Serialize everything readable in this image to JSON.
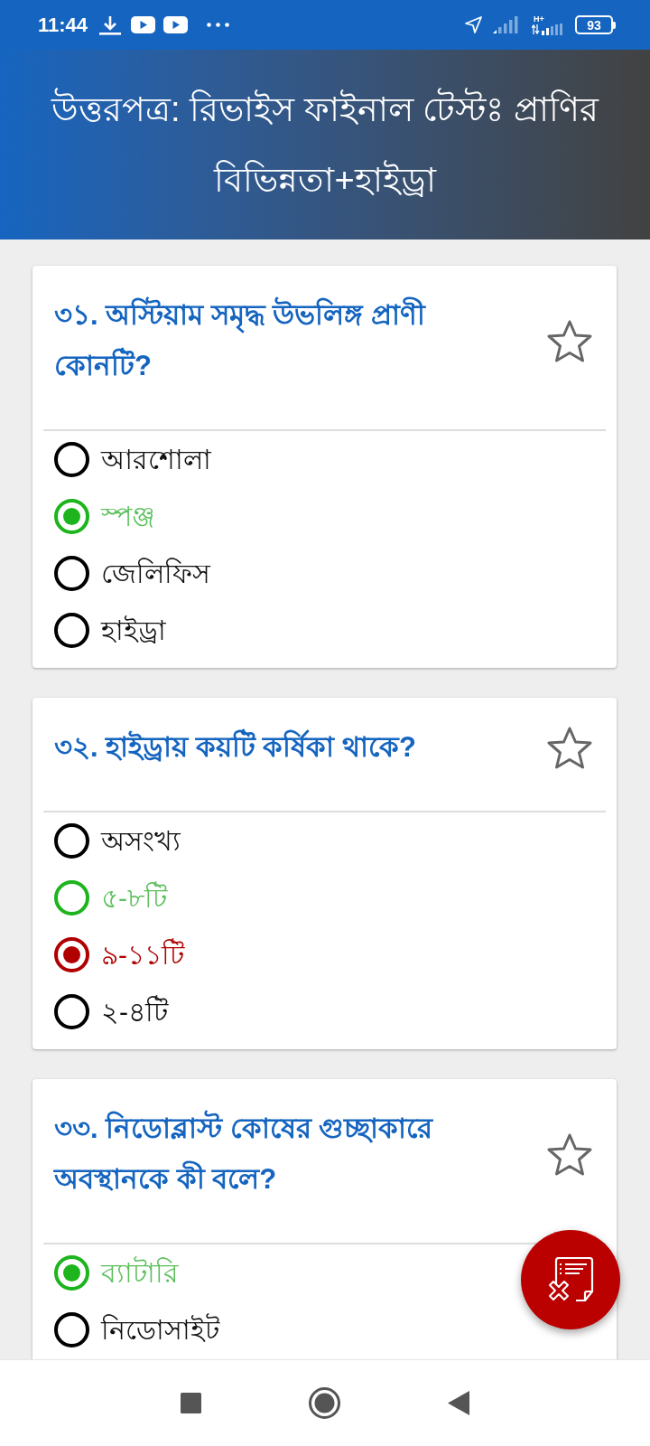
{
  "status_bar": {
    "time": "11:44",
    "network_type": "H+",
    "battery": "93"
  },
  "header": {
    "title": "উত্তরপত্র: রিভাইস ফাইনাল টেস্টঃ প্রাণির বিভিন্নতা+হাইড্রা"
  },
  "questions": [
    {
      "text": "৩১. অস্টিয়াম সমৃদ্ধ উভলিঙ্গ প্রাণী কোনটি?",
      "starred": false,
      "options": [
        {
          "text": "আরশোলা",
          "selected": false,
          "correct": false
        },
        {
          "text": "স্পঞ্জ",
          "selected": true,
          "correct": true
        },
        {
          "text": "জেলিফিস",
          "selected": false,
          "correct": false
        },
        {
          "text": "হাইড্রা",
          "selected": false,
          "correct": false
        }
      ]
    },
    {
      "text": "৩২. হাইড্রায় কয়টি কর্ষিকা থাকে?",
      "starred": false,
      "options": [
        {
          "text": "অসংখ্য",
          "selected": false,
          "correct": false
        },
        {
          "text": "৫-৮টি",
          "selected": false,
          "correct": true
        },
        {
          "text": "৯-১১টি",
          "selected": true,
          "correct": false
        },
        {
          "text": "২-৪টি",
          "selected": false,
          "correct": false
        }
      ]
    },
    {
      "text": "৩৩. নিডোব্লাস্ট কোষের গুচ্ছাকারে অবস্থানকে কী বলে?",
      "starred": false,
      "options": [
        {
          "text": "ব্যাটারি",
          "selected": true,
          "correct": true
        },
        {
          "text": "নিডোসাইট",
          "selected": false,
          "correct": false
        }
      ]
    }
  ]
}
